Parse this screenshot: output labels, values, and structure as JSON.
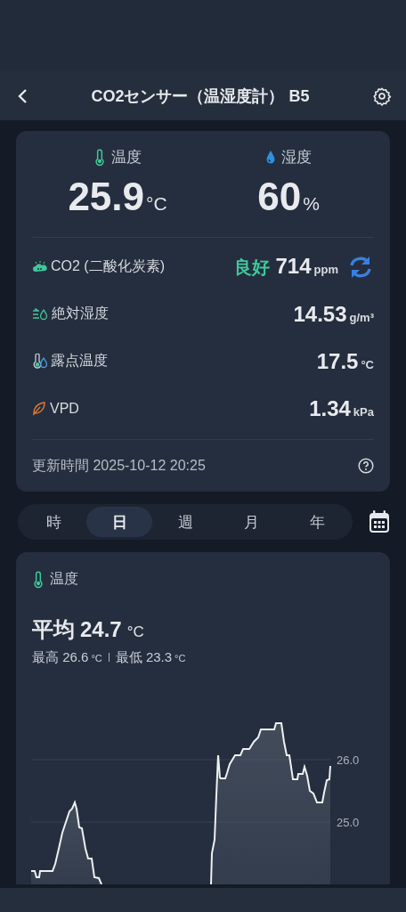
{
  "header": {
    "title": "CO2センサー（温湿度計） B5"
  },
  "summary": {
    "primary": [
      {
        "kind": "temperature",
        "label": "温度",
        "value": "25.9",
        "unit": "°C"
      },
      {
        "kind": "humidity",
        "label": "湿度",
        "value": "60",
        "unit": "%"
      }
    ],
    "metrics": [
      {
        "kind": "co2",
        "label": "CO2 (二酸化炭素)",
        "status": "良好",
        "value": "714",
        "unit": "ppm"
      },
      {
        "kind": "absolute_humidity",
        "label": "絶対湿度",
        "value": "14.53",
        "unit": "g/m³"
      },
      {
        "kind": "dew_point",
        "label": "露点温度",
        "value": "17.5",
        "unit": "°C"
      },
      {
        "kind": "vpd",
        "label": "VPD",
        "value": "1.34",
        "unit": "kPa"
      }
    ],
    "updated": "更新時間 2025-10-12 20:25"
  },
  "periods": [
    {
      "label": "時",
      "selected": false
    },
    {
      "label": "日",
      "selected": true
    },
    {
      "label": "週",
      "selected": false
    },
    {
      "label": "月",
      "selected": false
    },
    {
      "label": "年",
      "selected": false
    }
  ],
  "chart": {
    "title": "温度",
    "average_label": "平均",
    "average": "24.7",
    "unit": "°C",
    "max_label": "最高",
    "max": "26.6",
    "max_unit": "°C",
    "min_label": "最低",
    "min": "23.3",
    "min_unit": "°C",
    "y_labels": [
      "26.0",
      "25.0"
    ]
  }
}
